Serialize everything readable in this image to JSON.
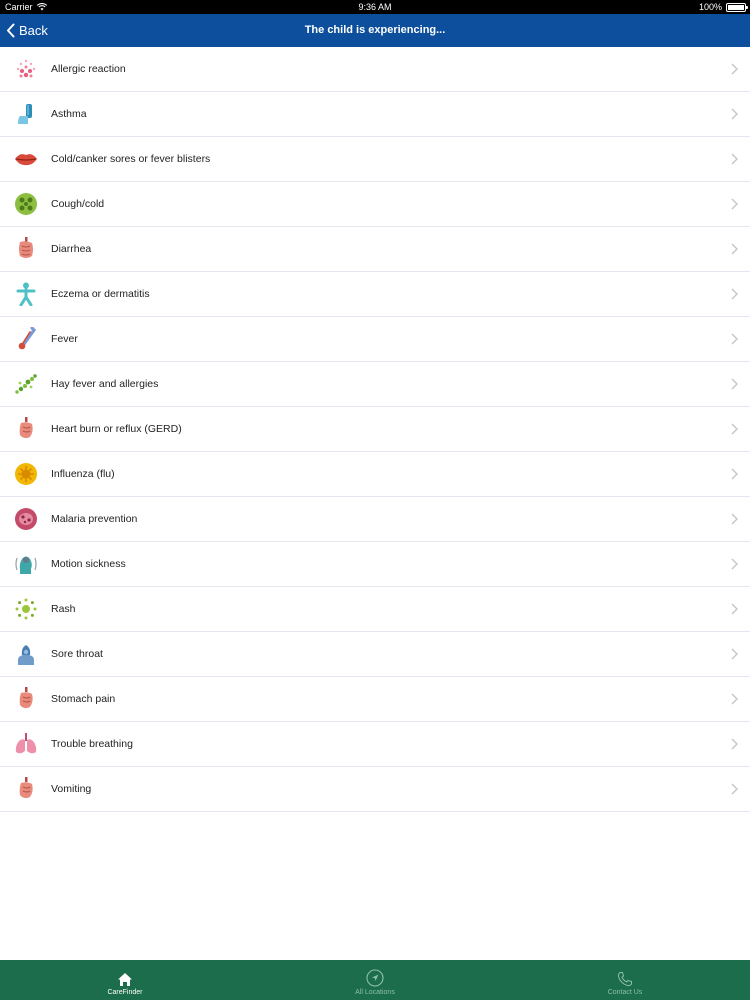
{
  "status": {
    "carrier": "Carrier",
    "time": "9:36 AM",
    "battery": "100%"
  },
  "nav": {
    "back_label": "Back",
    "title": "The child is experiencing..."
  },
  "items": [
    {
      "label": "Allergic reaction",
      "icon": "allergic-reaction-icon"
    },
    {
      "label": "Asthma",
      "icon": "inhaler-icon"
    },
    {
      "label": "Cold/canker sores or fever blisters",
      "icon": "lips-icon"
    },
    {
      "label": "Cough/cold",
      "icon": "virus-icon"
    },
    {
      "label": "Diarrhea",
      "icon": "intestine-icon"
    },
    {
      "label": "Eczema or dermatitis",
      "icon": "body-icon"
    },
    {
      "label": "Fever",
      "icon": "thermometer-icon"
    },
    {
      "label": "Hay fever and allergies",
      "icon": "pollen-icon"
    },
    {
      "label": "Heart burn or reflux (GERD)",
      "icon": "stomach-icon"
    },
    {
      "label": "Influenza (flu)",
      "icon": "flu-virus-icon"
    },
    {
      "label": "Malaria prevention",
      "icon": "mosquito-cell-icon"
    },
    {
      "label": "Motion sickness",
      "icon": "head-icon"
    },
    {
      "label": "Rash",
      "icon": "rash-icon"
    },
    {
      "label": "Sore throat",
      "icon": "throat-icon"
    },
    {
      "label": "Stomach pain",
      "icon": "stomach-icon"
    },
    {
      "label": "Trouble breathing",
      "icon": "lungs-icon"
    },
    {
      "label": "Vomiting",
      "icon": "stomach-icon"
    }
  ],
  "tabs": [
    {
      "label": "CareFinder",
      "icon": "home-icon",
      "active": true
    },
    {
      "label": "All Locations",
      "icon": "location-arrow-icon",
      "active": false
    },
    {
      "label": "Contact Us",
      "icon": "phone-icon",
      "active": false
    }
  ],
  "colors": {
    "nav": "#0d4f9c",
    "tabbar": "#1b6d4b",
    "divider": "#e8e4ef"
  }
}
